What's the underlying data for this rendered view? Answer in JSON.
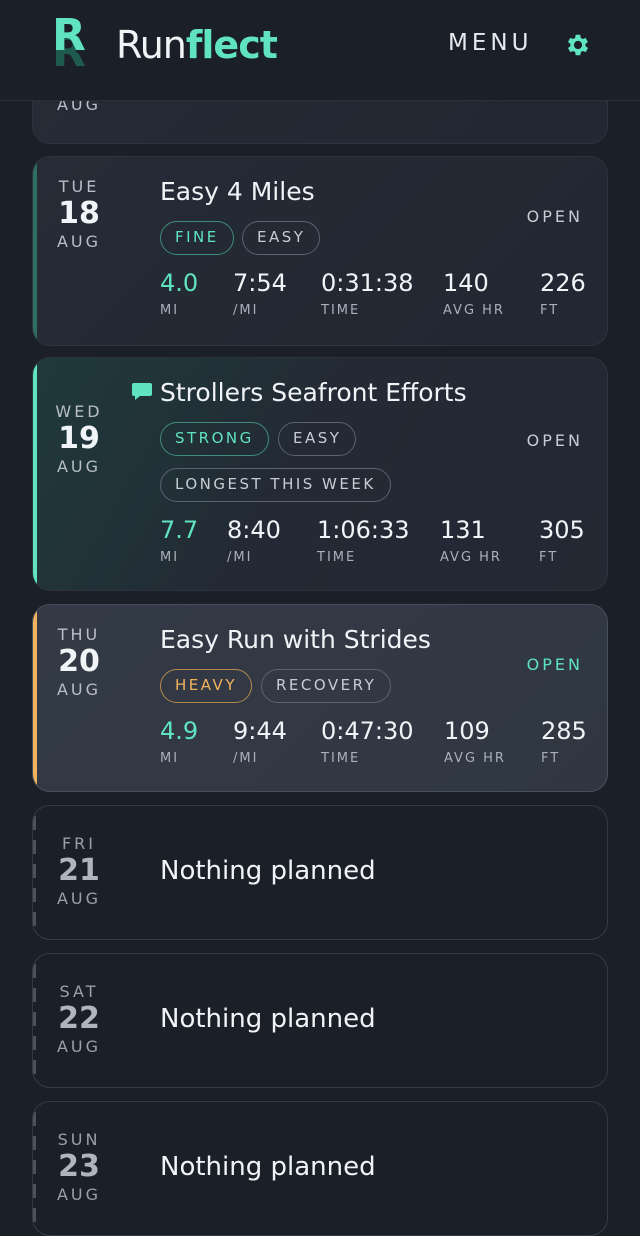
{
  "header": {
    "logo_letter": "R",
    "brand_run": "Run",
    "brand_flect": "flect",
    "menu_label": "MENU",
    "settings_icon": "gear-icon"
  },
  "colors": {
    "accent_teal": "#5fe3c0",
    "accent_orange": "#f2b35e",
    "background": "#1b1f28"
  },
  "partial_card": {
    "month": "AUG"
  },
  "days": [
    {
      "dow": "TUE",
      "day": "18",
      "month": "AUG",
      "title": "Easy 4 Miles",
      "open_label": "OPEN",
      "tags": [
        "FINE",
        "EASY"
      ],
      "stats": [
        {
          "value": "4.0",
          "unit": "MI"
        },
        {
          "value": "7:54",
          "unit": "/MI"
        },
        {
          "value": "0:31:38",
          "unit": "TIME"
        },
        {
          "value": "140",
          "unit": "AVG HR"
        },
        {
          "value": "226",
          "unit": "FT"
        }
      ]
    },
    {
      "dow": "WED",
      "day": "19",
      "month": "AUG",
      "title": "Strollers Seafront Efforts",
      "open_label": "OPEN",
      "tags": [
        "STRONG",
        "EASY",
        "LONGEST THIS WEEK"
      ],
      "stats": [
        {
          "value": "7.7",
          "unit": "MI"
        },
        {
          "value": "8:40",
          "unit": "/MI"
        },
        {
          "value": "1:06:33",
          "unit": "TIME"
        },
        {
          "value": "131",
          "unit": "AVG HR"
        },
        {
          "value": "305",
          "unit": "FT"
        }
      ]
    },
    {
      "dow": "THU",
      "day": "20",
      "month": "AUG",
      "title": "Easy Run with Strides",
      "open_label": "OPEN",
      "tags": [
        "HEAVY",
        "RECOVERY"
      ],
      "stats": [
        {
          "value": "4.9",
          "unit": "MI"
        },
        {
          "value": "9:44",
          "unit": "/MI"
        },
        {
          "value": "0:47:30",
          "unit": "TIME"
        },
        {
          "value": "109",
          "unit": "AVG HR"
        },
        {
          "value": "285",
          "unit": "FT"
        }
      ]
    },
    {
      "dow": "FRI",
      "day": "21",
      "month": "AUG",
      "text": "Nothing planned"
    },
    {
      "dow": "SAT",
      "day": "22",
      "month": "AUG",
      "text": "Nothing planned"
    },
    {
      "dow": "SUN",
      "day": "23",
      "month": "AUG",
      "text": "Nothing planned"
    }
  ]
}
